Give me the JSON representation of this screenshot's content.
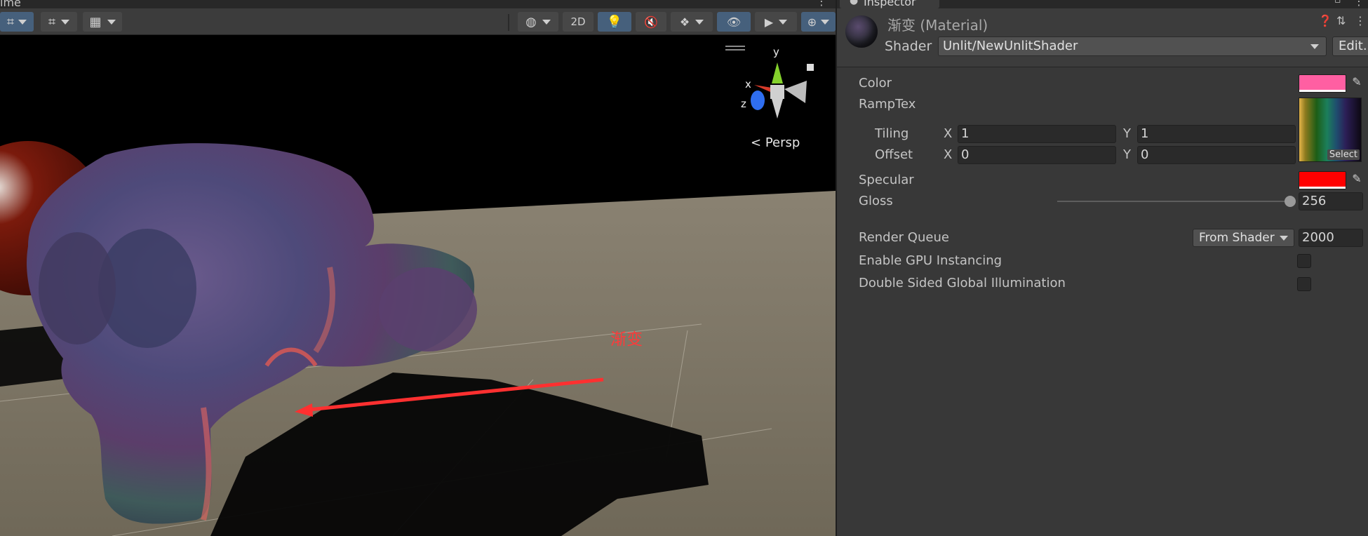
{
  "scene": {
    "tab_label": "ime",
    "toolbar": {
      "mode_2d": "2D"
    },
    "persp_label": "Persp",
    "gizmo_axes": {
      "x": "x",
      "y": "y",
      "z": "z"
    },
    "annotation": "渐变",
    "colors": {
      "floor": "#7a7262",
      "annotation": "#ff3a3a"
    }
  },
  "inspector": {
    "tab_label": "Inspector",
    "material_title": "渐变 (Material)",
    "shader_label": "Shader",
    "shader_value": "Unlit/NewUnlitShader",
    "edit_label": "Edit...",
    "properties": {
      "color_label": "Color",
      "color_value": "#ff5fa2",
      "ramptex_label": "RampTex",
      "ramptex_select": "Select",
      "tiling_label": "Tiling",
      "offset_label": "Offset",
      "x_label": "X",
      "y_label": "Y",
      "tiling_x": "1",
      "tiling_y": "1",
      "offset_x": "0",
      "offset_y": "0",
      "specular_label": "Specular",
      "specular_value": "#ff0000",
      "gloss_label": "Gloss",
      "gloss_value": "256"
    },
    "render_queue_label": "Render Queue",
    "render_queue_option": "From Shader",
    "render_queue_value": "2000",
    "gpu_instancing_label": "Enable GPU Instancing",
    "double_sided_gi_label": "Double Sided Global Illumination"
  }
}
